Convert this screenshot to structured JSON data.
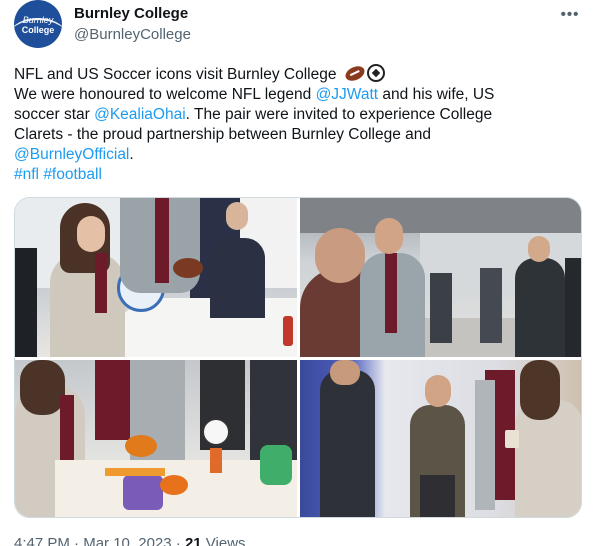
{
  "author": {
    "display_name": "Burnley College",
    "handle": "@BurnleyCollege",
    "avatar_logo_top": "Burnley",
    "avatar_logo_bottom": "College"
  },
  "menu": {
    "more_label": "•••"
  },
  "tweet": {
    "line1": "NFL and US Soccer icons visit Burnley College",
    "line2_a": "We were honoured to welcome NFL legend ",
    "mention_jjwatt": "@JJWatt",
    "line2_b": " and his wife, US",
    "line3_a": "soccer star ",
    "mention_kealia": "@KealiaOhai",
    "line3_b": ". The pair were invited to experience College",
    "line4": "Clarets - the proud partnership between Burnley College and",
    "mention_burnley": "@BurnleyOfficial",
    "line5_b": ".",
    "hashtag_nfl": "#nfl",
    "hashtag_football": "#football",
    "emojis": [
      "american-football",
      "soccer-ball"
    ]
  },
  "media": {
    "photos": [
      {
        "name": "photo-1"
      },
      {
        "name": "photo-2"
      },
      {
        "name": "photo-3"
      },
      {
        "name": "photo-4"
      }
    ]
  },
  "footer": {
    "time": "4:47 PM",
    "separator": " · ",
    "date": "Mar 10, 2023",
    "views_count": "21",
    "views_label": " Views"
  },
  "colors": {
    "link": "#1d9bf0",
    "text": "#0f1419",
    "secondary": "#536471",
    "avatar_bg": "#1f4f9a"
  }
}
